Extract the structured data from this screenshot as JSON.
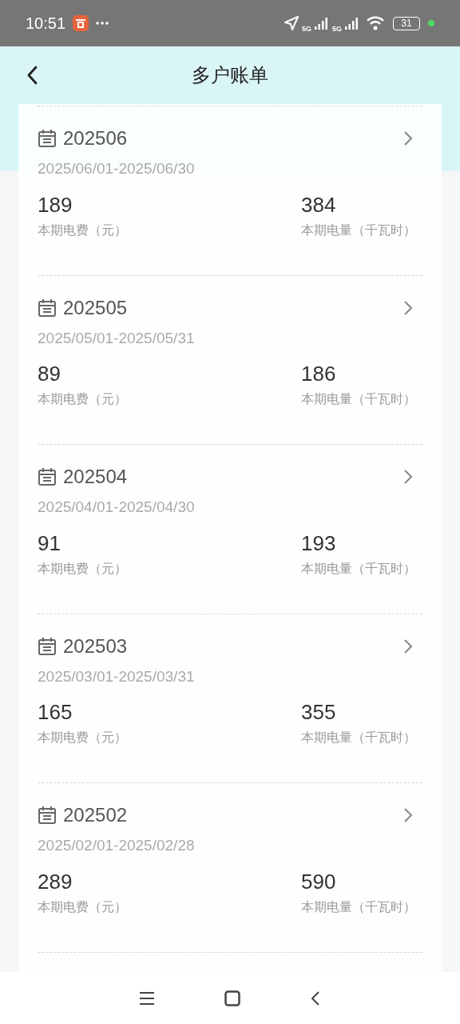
{
  "status_bar": {
    "time": "10:51",
    "network_1": "5G",
    "network_2": "5G",
    "battery": "31"
  },
  "header": {
    "title": "多户账单"
  },
  "bills": [
    {
      "period": "202506",
      "date_range": "2025/06/01-2025/06/30",
      "fee": "189",
      "fee_label": "本期电费（元）",
      "usage": "384",
      "usage_label": "本期电量（千瓦时）"
    },
    {
      "period": "202505",
      "date_range": "2025/05/01-2025/05/31",
      "fee": "89",
      "fee_label": "本期电费（元）",
      "usage": "186",
      "usage_label": "本期电量（千瓦时）"
    },
    {
      "period": "202504",
      "date_range": "2025/04/01-2025/04/30",
      "fee": "91",
      "fee_label": "本期电费（元）",
      "usage": "193",
      "usage_label": "本期电量（千瓦时）"
    },
    {
      "period": "202503",
      "date_range": "2025/03/01-2025/03/31",
      "fee": "165",
      "fee_label": "本期电费（元）",
      "usage": "355",
      "usage_label": "本期电量（千瓦时）"
    },
    {
      "period": "202502",
      "date_range": "2025/02/01-2025/02/28",
      "fee": "289",
      "fee_label": "本期电费（元）",
      "usage": "590",
      "usage_label": "本期电量（千瓦时）"
    }
  ]
}
